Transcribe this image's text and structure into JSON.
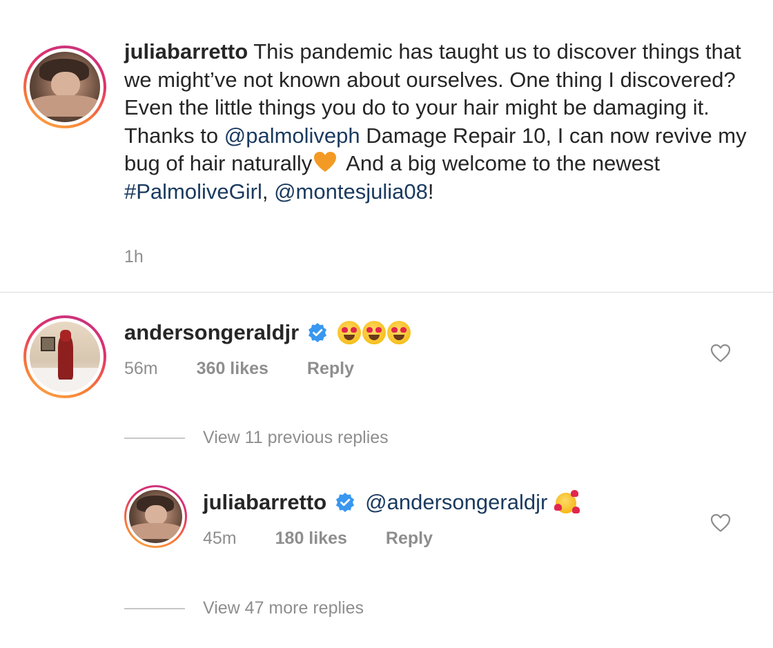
{
  "post": {
    "username": "juliabarretto",
    "caption_part1": " This pandemic has taught us to discover things that we might’ve not known about ourselves. One thing I discovered? Even the little things you do to your hair might be damaging it. Thanks to ",
    "mention_palmolive": "@palmoliveph",
    "caption_part2": " Damage Repair 10, I can now revive my bug of hair naturally",
    "caption_part3": " And a big welcome to the newest ",
    "hashtag": "#PalmoliveGirl",
    "separator": ", ",
    "mention_montes": "@montesjulia08",
    "caption_end": "!",
    "time": "1h"
  },
  "comment": {
    "username": "andersongeraldjr",
    "time": "56m",
    "likes": "360 likes",
    "reply_label": "Reply",
    "view_previous": "View 11 previous replies"
  },
  "reply": {
    "username": "juliabarretto",
    "mention": "@andersongeraldjr",
    "time": "45m",
    "likes": "180 likes",
    "reply_label": "Reply",
    "view_more": "View 47 more replies"
  },
  "colors": {
    "link": "#1a3a5f",
    "meta": "#8e8e8e",
    "verified": "#3897f0"
  }
}
